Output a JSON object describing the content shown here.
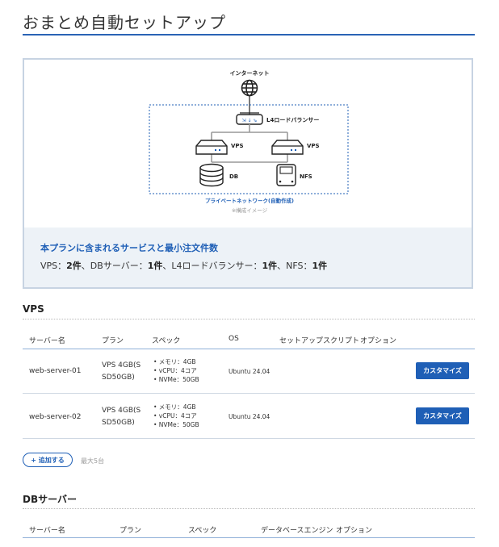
{
  "page": {
    "title": "おまとめ自動セットアップ"
  },
  "diagram": {
    "internet_label": "インターネット",
    "lb_label": "L4ロードバランサー",
    "vps1_label": "VPS",
    "vps2_label": "VPS",
    "db_label": "DB",
    "nfs_label": "NFS",
    "network_label": "プライベートネットワーク(自動作成)",
    "caption": "※構成イメージ",
    "accent_color": "#1f5fb6"
  },
  "plan_summary": {
    "heading": "本プランに含まれるサービスと最小注文件数",
    "vps_label": "VPS：",
    "vps_count": "2件",
    "db_label": "、DBサーバー：",
    "db_count": "1件",
    "lb_label": "、L4ロードバランサー：",
    "lb_count": "1件",
    "nfs_label": "、NFS：",
    "nfs_count": "1件"
  },
  "vps_section": {
    "heading": "VPS",
    "columns": [
      "サーバー名",
      "プラン",
      "スペック",
      "OS",
      "セットアップスクリプト",
      "オプション"
    ],
    "rows": [
      {
        "name": "web-server-01",
        "plan": "VPS 4GB(SSD50GB)",
        "plan_line1": "VPS 4GB(S",
        "plan_line2": "SD50GB)",
        "spec": [
          "• メモリ：4GB",
          "• vCPU：4コア",
          "• NVMe：50GB"
        ],
        "os": "Ubuntu 24.04",
        "button": "カスタマイズ"
      },
      {
        "name": "web-server-02",
        "plan": "VPS 4GB(SSD50GB)",
        "plan_line1": "VPS 4GB(S",
        "plan_line2": "SD50GB)",
        "spec": [
          "• メモリ：4GB",
          "• vCPU：4コア",
          "• NVMe：50GB"
        ],
        "os": "Ubuntu 24.04",
        "button": "カスタマイズ"
      }
    ],
    "add_button": "+ 追加する",
    "max_note": "最大5台"
  },
  "db_section": {
    "heading": "DBサーバー",
    "columns": [
      "サーバー名",
      "プラン",
      "スペック",
      "データベースエンジン",
      "オプション"
    ]
  }
}
